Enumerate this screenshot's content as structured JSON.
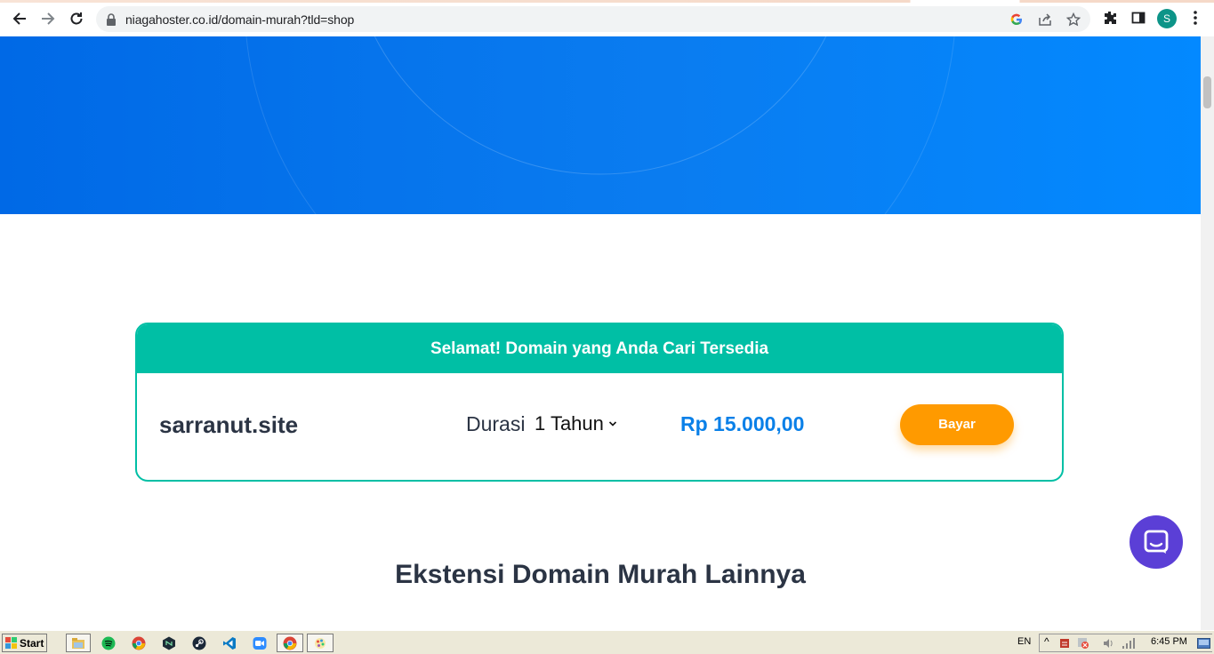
{
  "browser": {
    "url": "niagahoster.co.id/domain-murah?tld=shop",
    "avatar_letter": "S"
  },
  "card": {
    "header": "Selamat! Domain yang Anda Cari Tersedia",
    "domain": "sarranut.site",
    "duration_label": "Durasi",
    "duration_value": "1 Tahun",
    "price": "Rp 15.000,00",
    "pay_button": "Bayar"
  },
  "section_title": "Ekstensi Domain Murah Lainnya",
  "taskbar": {
    "start_label": "Start",
    "language": "EN",
    "clock": "6:45 PM"
  },
  "colors": {
    "hero_blue": "#0069e6",
    "teal": "#00bfa5",
    "orange": "#ff9a00",
    "price_blue": "#0a80e8",
    "chat_purple": "#5b3fd6"
  },
  "icons": [
    "back-icon",
    "forward-icon",
    "reload-icon",
    "lock-icon",
    "google-icon",
    "share-icon",
    "star-icon",
    "extensions-icon",
    "sidepanel-icon",
    "menu-icon",
    "chevron-down-icon",
    "chat-icon",
    "windows-logo-icon"
  ]
}
